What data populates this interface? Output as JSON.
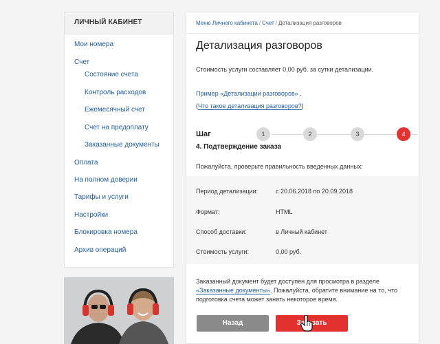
{
  "sidebar": {
    "header": "ЛИЧНЫЙ КАБИНЕТ",
    "items": [
      {
        "label": "Мои номера"
      },
      {
        "label": "Счет"
      },
      {
        "label": "Состояние счета"
      },
      {
        "label": "Контроль расходов"
      },
      {
        "label": "Ежемесячный счет"
      },
      {
        "label": "Счет на предоплату"
      },
      {
        "label": "Заказанные документы"
      },
      {
        "label": "Оплата"
      },
      {
        "label": "На полном доверии"
      },
      {
        "label": "Тарифы и услуги"
      },
      {
        "label": "Настройки"
      },
      {
        "label": "Блокировка номера"
      },
      {
        "label": "Архив операций"
      }
    ]
  },
  "breadcrumb": {
    "items": [
      "Меню Личного кабинета",
      "Счет",
      "Детализация разговоров"
    ],
    "separator": "/"
  },
  "page": {
    "title": "Детализация разговоров",
    "cost_note": "Стоимость услуги составляет 0,00 руб. за сутки детализации.",
    "example_link": "Пример «Детализации разговоров»",
    "example_suffix": " .",
    "what_open": "(",
    "what_link": "Что такое детализация разговоров?",
    "what_close": ")"
  },
  "steps": {
    "word": "Шаг",
    "numbers": [
      "1",
      "2",
      "3",
      "4"
    ],
    "active": 4,
    "current_title": "4. Подтверждение заказа"
  },
  "verify_note": "Пожалуйста, проверьте правильность введенных данных:",
  "summary": [
    {
      "label": "Период детализации:",
      "value": "с 20.06.2018 по 20.09.2018"
    },
    {
      "label": "Формат:",
      "value": "HTML"
    },
    {
      "label": "Способ доставки:",
      "value": "в Личный кабинет"
    },
    {
      "label": "Стоимость услуги:",
      "value": "0,00 руб."
    }
  ],
  "doc_note": {
    "before": "Заказанный документ будет доступен для просмотра в разделе",
    "link": "«Заказанные документы»",
    "after": ". Пожалуйста, обратите внимание на то, что подготовка счета может занять некоторое время."
  },
  "buttons": {
    "back": "Назад",
    "order": "Заказать"
  },
  "colors": {
    "accent_red": "#e2312f",
    "link_blue": "#1f5c9c",
    "back_gray": "#8a8a8a"
  }
}
